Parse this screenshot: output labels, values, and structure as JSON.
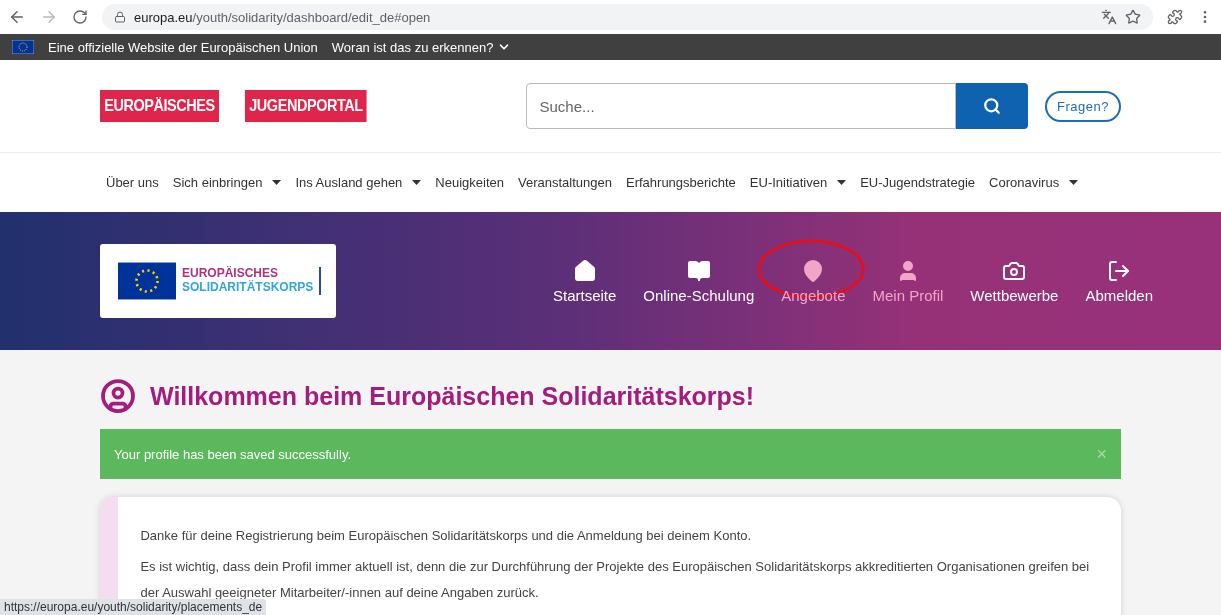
{
  "browser": {
    "url_host": "europa.eu",
    "url_path": "/youth/solidarity/dashboard/edit_de#open"
  },
  "eu_bar": {
    "text": "Eine offizielle Website der Europäischen Union",
    "link": "Woran ist das zu erkennen?"
  },
  "header": {
    "logo_words": [
      "EUROPÄISCHES",
      "JUGENDPORTAL"
    ],
    "search": {
      "placeholder": "Suche..."
    },
    "help_button": "Fragen?"
  },
  "nav": [
    {
      "label": "Über uns",
      "dropdown": false
    },
    {
      "label": "Sich einbringen",
      "dropdown": true
    },
    {
      "label": "Ins Ausland gehen",
      "dropdown": true
    },
    {
      "label": "Neuigkeiten",
      "dropdown": false
    },
    {
      "label": "Veranstaltungen",
      "dropdown": false
    },
    {
      "label": "Erfahrungsberichte",
      "dropdown": false
    },
    {
      "label": "EU-Initiativen",
      "dropdown": true
    },
    {
      "label": "EU-Jugendstrategie",
      "dropdown": false
    },
    {
      "label": "Coronavirus",
      "dropdown": true
    }
  ],
  "hero": {
    "logo_lines": [
      "EUROPÄISCHES",
      "SOLIDARITÄTSKORPS"
    ],
    "menu": [
      {
        "kind": "home",
        "label": "Startseite",
        "highlighted": false,
        "circled": false
      },
      {
        "kind": "book",
        "label": "Online-Schulung",
        "highlighted": false,
        "circled": false
      },
      {
        "kind": "pin",
        "label": "Angebote",
        "highlighted": true,
        "circled": true
      },
      {
        "kind": "person",
        "label": "Mein Profil",
        "highlighted": true,
        "circled": false
      },
      {
        "kind": "camera",
        "label": "Wettbewerbe",
        "highlighted": false,
        "circled": false
      },
      {
        "kind": "logout",
        "label": "Abmelden",
        "highlighted": false,
        "circled": false
      }
    ]
  },
  "welcome": {
    "title": "Willkommen beim Europäischen Solidaritätskorps!"
  },
  "alert": {
    "message": "Your profile has been saved successfully.",
    "close": "×"
  },
  "card": {
    "paragraphs": [
      "Danke für deine Registrierung beim Europäischen Solidaritätskorps und die Anmeldung bei deinem Konto.",
      "Es ist wichtig, dass dein Profil immer aktuell ist, denn die zur Durchführung der Projekte des Europäischen Solidaritätskorps akkreditierten Organisationen greifen bei der Auswahl geeigneter Mitarbeiter/-innen auf deine Angaben zurück."
    ]
  },
  "status_url": "https://europa.eu/youth/solidarity/placements_de"
}
